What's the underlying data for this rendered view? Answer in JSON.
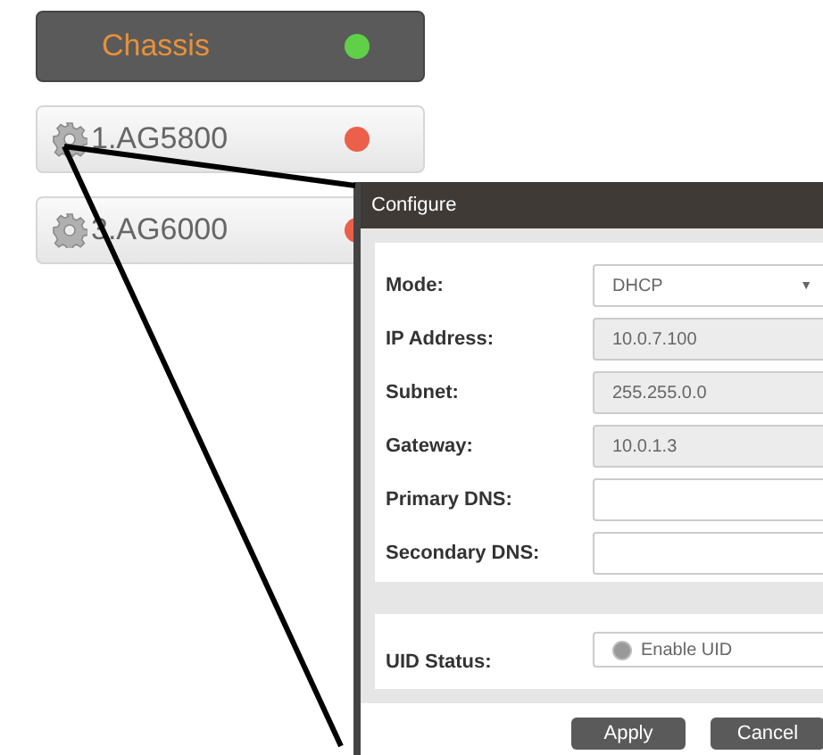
{
  "devices": [
    {
      "kind": "chassis",
      "label": "Chassis",
      "selected": true,
      "color": "#5fd048"
    },
    {
      "kind": "module",
      "label": "1.AG5800",
      "selected": false,
      "color": "#ec5f4a"
    },
    {
      "kind": "module",
      "label": "3.AG6000",
      "selected": false,
      "color": "#ec5f4a"
    }
  ],
  "dialog": {
    "title": "Configure",
    "fields": [
      {
        "kind": "select",
        "label": "Mode:",
        "value": "DHCP",
        "caret": "▼"
      },
      {
        "kind": "readonly",
        "label": "IP Address:",
        "value": "10.0.7.100"
      },
      {
        "kind": "readonly",
        "label": "Subnet:",
        "value": "255.255.0.0"
      },
      {
        "kind": "readonly",
        "label": "Gateway:",
        "value": "10.0.1.3"
      },
      {
        "kind": "input",
        "label": "Primary DNS:"
      },
      {
        "kind": "input",
        "label": "Secondary DNS:"
      }
    ],
    "uid": {
      "label": "UID Status:",
      "option": "Enable UID",
      "checked": false
    },
    "buttons": [
      "Apply",
      "Cancel"
    ]
  }
}
